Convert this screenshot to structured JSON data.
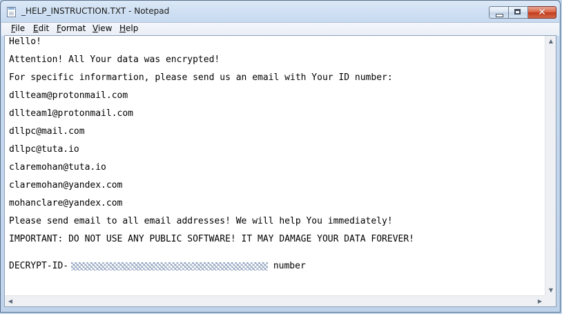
{
  "window": {
    "title": "_HELP_INSTRUCTION.TXT - Notepad",
    "controls": {
      "minimize": "",
      "maximize": "",
      "close": "✕"
    }
  },
  "menu": [
    "File",
    "Edit",
    "Format",
    "View",
    "Help"
  ],
  "document": {
    "lines": [
      "Hello!",
      "Attention! All Your data was encrypted!",
      "For specific informartion, please send us an email with Your ID number:",
      "dllteam@protonmail.com",
      "dllteam1@protonmail.com",
      "dllpc@mail.com",
      "dllpc@tuta.io",
      "claremohan@tuta.io",
      "claremohan@yandex.com",
      "mohanclare@yandex.com",
      "Please send email to all email addresses! We will help You immediately!",
      "IMPORTANT: DO NOT USE ANY PUBLIC SOFTWARE! IT MAY DAMAGE YOUR DATA FOREVER!"
    ],
    "decrypt_prefix": "DECRYPT-ID-",
    "decrypt_suffix": " number"
  },
  "scrollbar": {
    "up_icon": "triangle-up-icon",
    "down_icon": "triangle-down-icon",
    "left_icon": "triangle-left-icon",
    "right_icon": "triangle-right-icon"
  }
}
